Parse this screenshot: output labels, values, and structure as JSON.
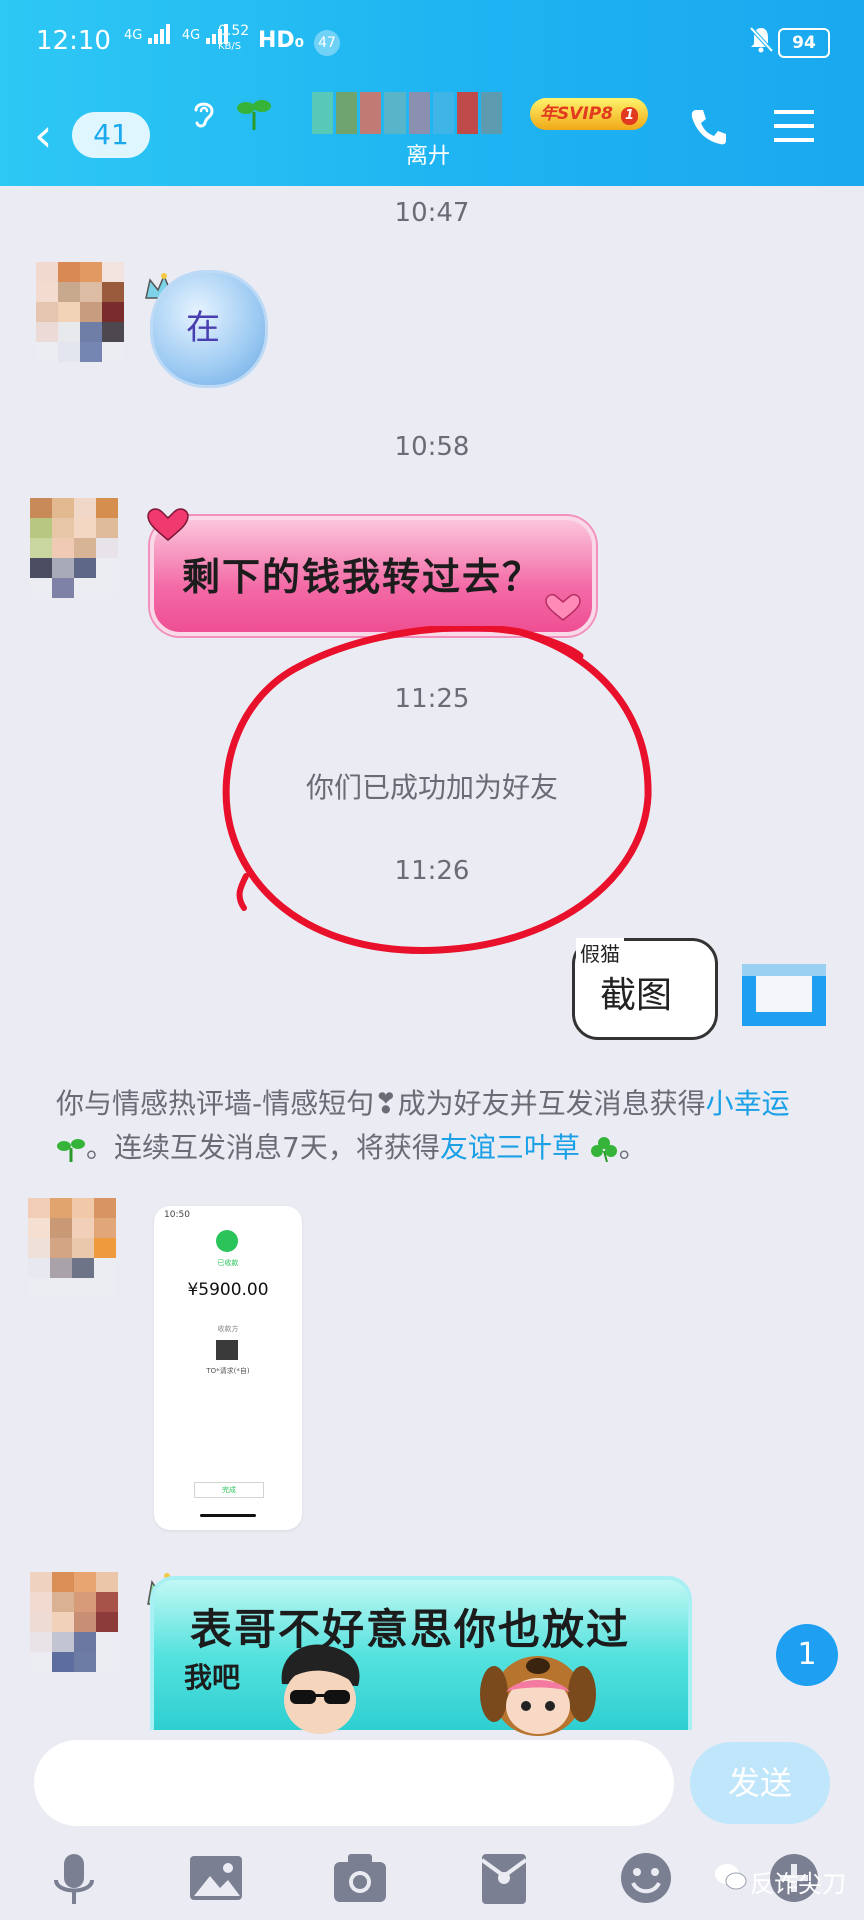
{
  "status_bar": {
    "time": "12:10",
    "net1": "4G",
    "net2": "4G",
    "speed_value": "0.52",
    "speed_unit": "KB/S",
    "hd": "HD₀",
    "notification_count": "47",
    "battery": "94"
  },
  "title_bar": {
    "back_count": "41",
    "subtitle": "离廾",
    "svip_label": "年SVIP8",
    "svip_level": "1"
  },
  "messages": {
    "time1": "10:47",
    "sticker1_text": "在",
    "time2": "10:58",
    "sticker2_text": "剩下的钱我转过去？",
    "time3": "11:25",
    "system_added": "你们已成功加为好友",
    "time4": "11:26",
    "fake_tag": "假猫",
    "fake_text": "截图",
    "notice_part1": "你与情感热评墙-情感短句❣成为好友并互发消息获得",
    "notice_link1": "小幸运",
    "notice_part2": "。连续互发消息7天，将获得",
    "notice_link2": "友谊三叶草",
    "notice_part3": "。",
    "receipt_time": "10:50",
    "receipt_status": "已收款",
    "receipt_amount": "¥5900.00",
    "receipt_payer_label": "收款方",
    "receipt_name": "TO*请求(*自)",
    "receipt_button": "完成",
    "sticker3_line1": "表哥不好意思你也放过",
    "sticker3_line2": "我吧"
  },
  "unread_badge": "1",
  "input": {
    "placeholder": "",
    "send_label": "发送"
  },
  "toolbar_icons": [
    "microphone-icon",
    "image-icon",
    "camera-icon",
    "red-packet-icon",
    "emoji-icon",
    "plus-icon"
  ],
  "watermark": "反诈尖刀",
  "colors": {
    "header_blue": "#1fb5f2",
    "background": "#ebecf3",
    "link_blue": "#1aa0e6",
    "annotation_red": "#e8102a",
    "send_disabled": "#bfe6fb"
  }
}
